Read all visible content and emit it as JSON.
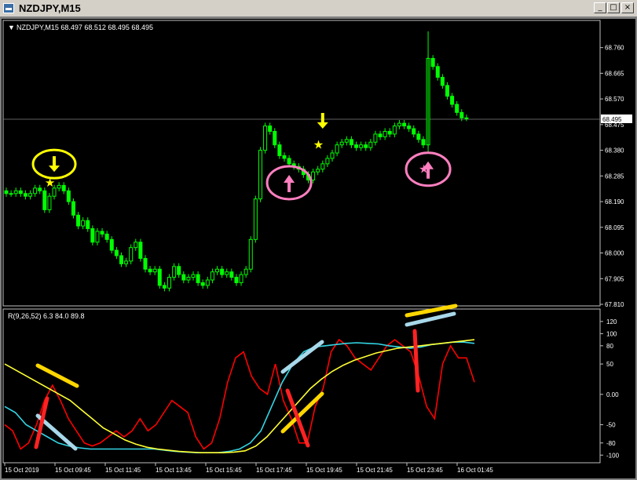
{
  "window": {
    "title": "NZDJPY,M15",
    "minimize_glyph": "_",
    "restore_glyph": "□",
    "close_glyph": "×"
  },
  "colors": {
    "background": "#000000",
    "candle": "#00ff00",
    "grid": "#2b2b2b",
    "axis": "#c0c0c0",
    "text": "#ffffff",
    "yellow_signal": "#ffff00",
    "pink_signal": "#ff7fc0",
    "red_line": "#ff0000",
    "cyan_line": "#33d6e6",
    "yellow_line": "#ffff33"
  },
  "header": {
    "symbol_arrow": "▼",
    "symbol_text": "NZDJPY,M15  68.497 68.512 68.495 68.495"
  },
  "indicator": {
    "label": "R(9,26,52) 6.3 84.0 89.8"
  },
  "chart_data": [
    {
      "type": "candlestick",
      "title": "NZDJPY,M15",
      "ohlc_header": [
        "68.497",
        "68.512",
        "68.495",
        "68.495"
      ],
      "current_price": "68.495",
      "y_ticks": [
        "68.760",
        "68.665",
        "68.570",
        "68.475",
        "68.380",
        "68.285",
        "68.190",
        "68.095",
        "68.000",
        "67.905",
        "67.810"
      ],
      "ylim": [
        67.81,
        68.82
      ],
      "x_ticks": [
        "15 Oct 2019",
        "15 Oct 09:45",
        "15 Oct 11:45",
        "15 Oct 13:45",
        "15 Oct 15:45",
        "15 Oct 17:45",
        "15 Oct 19:45",
        "15 Oct 21:45",
        "15 Oct 23:45",
        "16 Oct 01:45"
      ],
      "closes": [
        68.22,
        68.22,
        68.23,
        68.22,
        68.21,
        68.22,
        68.24,
        68.23,
        68.16,
        68.21,
        68.24,
        68.25,
        68.23,
        68.19,
        68.14,
        68.1,
        68.12,
        68.09,
        68.04,
        68.08,
        68.07,
        68.05,
        68.01,
        67.99,
        67.96,
        67.97,
        68.02,
        68.04,
        67.98,
        67.94,
        67.93,
        67.94,
        67.88,
        67.87,
        67.91,
        67.95,
        67.92,
        67.9,
        67.91,
        67.92,
        67.89,
        67.88,
        67.9,
        67.93,
        67.94,
        67.92,
        67.93,
        67.91,
        67.89,
        67.92,
        67.94,
        68.05,
        68.2,
        68.38,
        68.47,
        68.45,
        68.4,
        68.36,
        68.35,
        68.33,
        68.32,
        68.31,
        68.29,
        68.27,
        68.3,
        68.31,
        68.33,
        68.35,
        68.37,
        68.4,
        68.41,
        68.42,
        68.4,
        68.39,
        68.4,
        68.39,
        68.41,
        68.44,
        68.43,
        68.45,
        68.44,
        68.47,
        68.48,
        68.47,
        68.46,
        68.44,
        68.42,
        68.4,
        68.72,
        68.69,
        68.65,
        68.62,
        68.58,
        68.55,
        68.52,
        68.5,
        68.5
      ],
      "signals": [
        {
          "kind": "yellow-down-arrow",
          "index": 10,
          "price": 68.3,
          "circled": true
        },
        {
          "kind": "yellow-star",
          "index": 9,
          "price": 68.26
        },
        {
          "kind": "yellow-down-arrow",
          "index": 66,
          "price": 68.46,
          "circled": false
        },
        {
          "kind": "yellow-star",
          "index": 65,
          "price": 68.4
        },
        {
          "kind": "pink-up-arrow",
          "index": 59,
          "price": 68.26,
          "circled": true
        },
        {
          "kind": "pink-up-arrow",
          "index": 88,
          "price": 68.31,
          "circled": true
        },
        {
          "kind": "pink-star",
          "index": 87,
          "price": 68.31
        }
      ]
    },
    {
      "type": "line",
      "title": "R(9,26,52) 6.3 84.0 89.8",
      "y_ticks": [
        "120",
        "100",
        "80",
        "50",
        "0.00",
        "-50",
        "-80",
        "-100"
      ],
      "ylim": [
        -110,
        125
      ],
      "series": [
        {
          "color": "#ff0000",
          "values": [
            -50,
            -60,
            -90,
            -80,
            -50,
            -10,
            15,
            -10,
            -40,
            -60,
            -80,
            -85,
            -80,
            -70,
            -60,
            -70,
            -60,
            -40,
            -60,
            -50,
            -30,
            -10,
            -20,
            -30,
            -70,
            -90,
            -80,
            -40,
            20,
            60,
            70,
            30,
            10,
            0,
            50,
            -10,
            -40,
            -80,
            -80,
            -20,
            10,
            70,
            90,
            80,
            60,
            50,
            40,
            60,
            80,
            90,
            80,
            70,
            30,
            -20,
            -40,
            50,
            80,
            60,
            60,
            20
          ]
        },
        {
          "color": "#33d6e6",
          "values": [
            -20,
            -30,
            -50,
            -60,
            -70,
            -80,
            -85,
            -88,
            -90,
            -90,
            -90,
            -90,
            -90,
            -90,
            -90,
            -92,
            -94,
            -95,
            -96,
            -96,
            -96,
            -94,
            -90,
            -80,
            -60,
            -20,
            20,
            50,
            70,
            78,
            80,
            82,
            84,
            85,
            84,
            83,
            80,
            78,
            76,
            78,
            82,
            84,
            86,
            86,
            84
          ]
        },
        {
          "color": "#ffff33",
          "values": [
            50,
            40,
            30,
            20,
            10,
            0,
            -10,
            -25,
            -40,
            -55,
            -65,
            -75,
            -82,
            -87,
            -90,
            -92,
            -94,
            -95,
            -96,
            -96,
            -96,
            -95,
            -93,
            -85,
            -70,
            -50,
            -30,
            -10,
            10,
            25,
            38,
            48,
            56,
            62,
            68,
            72,
            76,
            78,
            80,
            82,
            84,
            86,
            88,
            90
          ]
        }
      ]
    }
  ]
}
